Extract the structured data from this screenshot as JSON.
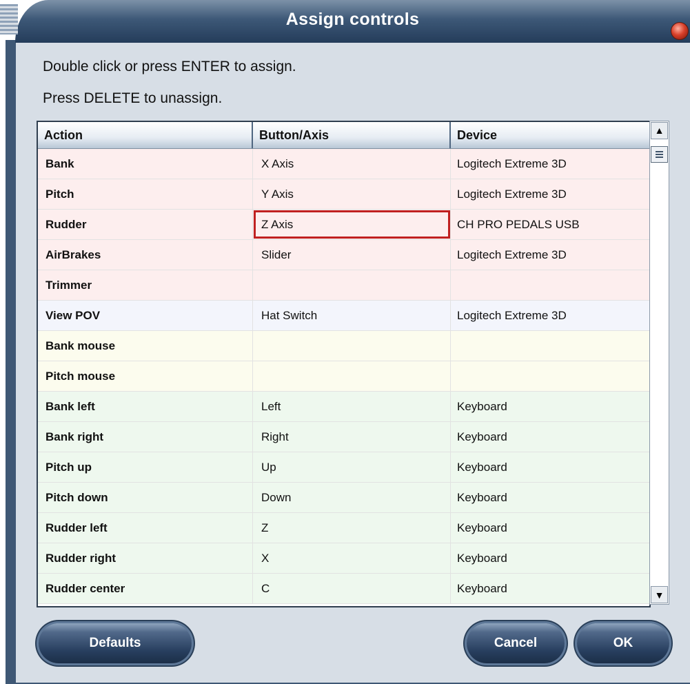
{
  "window": {
    "title": "Assign controls"
  },
  "instructions": {
    "line1": "Double click or press ENTER to assign.",
    "line2": "Press DELETE to unassign."
  },
  "table": {
    "headers": [
      "Action",
      "Button/Axis",
      "Device"
    ],
    "rows": [
      {
        "action": "Bank",
        "binding": "X Axis",
        "device": "Logitech Extreme 3D",
        "group": "axis"
      },
      {
        "action": "Pitch",
        "binding": "Y Axis",
        "device": "Logitech Extreme 3D",
        "group": "axis"
      },
      {
        "action": "Rudder",
        "binding": "Z Axis",
        "device": "CH PRO PEDALS USB",
        "group": "axis",
        "selected": true
      },
      {
        "action": "AirBrakes",
        "binding": "Slider",
        "device": "Logitech Extreme 3D",
        "group": "axis"
      },
      {
        "action": "Trimmer",
        "binding": "",
        "device": "",
        "group": "axis"
      },
      {
        "action": "View POV",
        "binding": "Hat Switch",
        "device": "Logitech Extreme 3D",
        "group": "pov"
      },
      {
        "action": "Bank mouse",
        "binding": "",
        "device": "",
        "group": "mouse"
      },
      {
        "action": "Pitch mouse",
        "binding": "",
        "device": "",
        "group": "mouse"
      },
      {
        "action": "Bank left",
        "binding": "Left",
        "device": "Keyboard",
        "group": "button"
      },
      {
        "action": "Bank right",
        "binding": "Right",
        "device": "Keyboard",
        "group": "button"
      },
      {
        "action": "Pitch up",
        "binding": "Up",
        "device": "Keyboard",
        "group": "button"
      },
      {
        "action": "Pitch down",
        "binding": "Down",
        "device": "Keyboard",
        "group": "button"
      },
      {
        "action": "Rudder left",
        "binding": "Z",
        "device": "Keyboard",
        "group": "button"
      },
      {
        "action": "Rudder right",
        "binding": "X",
        "device": "Keyboard",
        "group": "button"
      },
      {
        "action": "Rudder center",
        "binding": "C",
        "device": "Keyboard",
        "group": "button"
      }
    ]
  },
  "row_colors": {
    "axis": "#fdeeee",
    "pov": "#f3f5fc",
    "mouse": "#fcfcee",
    "button": "#eef8ee",
    "selection": "#c02020"
  },
  "buttons": {
    "defaults": "Defaults",
    "cancel": "Cancel",
    "ok": "OK"
  },
  "icons": {
    "close": "close-icon",
    "scroll_up": "arrow-up-icon",
    "scroll_down": "arrow-down-icon"
  }
}
